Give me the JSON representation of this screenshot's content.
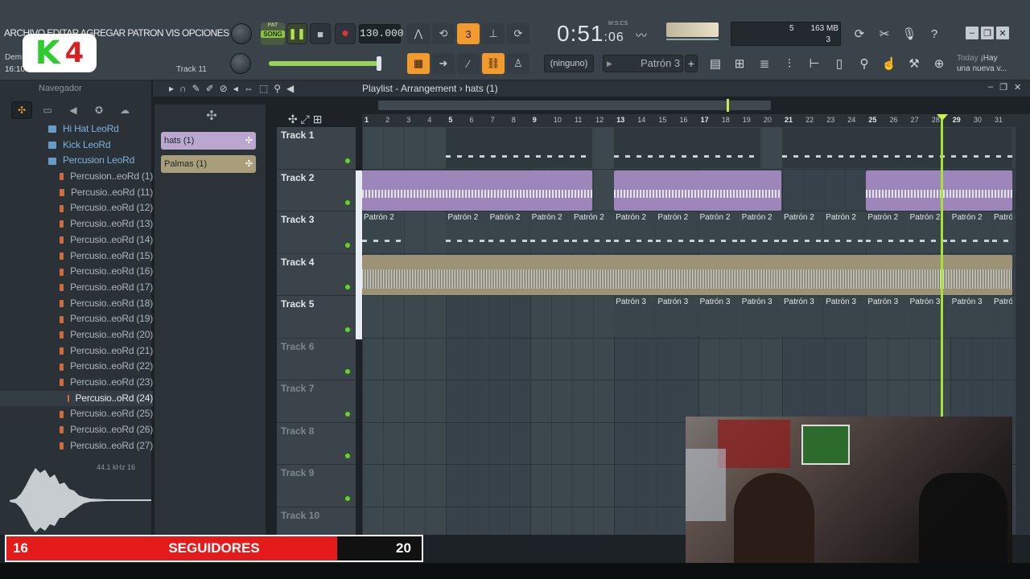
{
  "menu": {
    "text": "ARCHIVO EDITAR AGREGAR PATRON VIS OPCIONES HERRAMIENTA"
  },
  "hints": {
    "line1": "Dem",
    "line2": "16:10:1",
    "track": "Track 11"
  },
  "logo": {
    "k": "K",
    "num": "4"
  },
  "transport": {
    "pat": "PAT",
    "song": "SONG",
    "play": "❚❚",
    "stop": "■",
    "rec": "●",
    "tempo": "130.000"
  },
  "time": {
    "main": "0:51",
    "sub": ":06",
    "label": "M:S:CS"
  },
  "cpu": {
    "voices": "5",
    "mem": "163 MB",
    "poly": "3"
  },
  "pattern": {
    "none": "(ninguno)",
    "current": "Patrón 3",
    "plus": "+"
  },
  "news": {
    "line1": "Today",
    "line1b": "¡Hay",
    "line2": "una nueva v..."
  },
  "window_buttons": [
    "‒",
    "❐",
    "✕"
  ],
  "browser": {
    "title": "Navegador",
    "items": [
      {
        "label": "Hi Hat LeoRd",
        "type": "folder",
        "indent": 60
      },
      {
        "label": "Kick LeoRd",
        "type": "folder",
        "indent": 60
      },
      {
        "label": "Percusion  LeoRd",
        "type": "folder",
        "indent": 60
      },
      {
        "label": "Percusion..eoRd (1)",
        "type": "file",
        "indent": 74
      },
      {
        "label": "Percusio..eoRd (11)",
        "type": "file",
        "indent": 74
      },
      {
        "label": "Percusio..eoRd (12)",
        "type": "file",
        "indent": 74
      },
      {
        "label": "Percusio..eoRd (13)",
        "type": "file",
        "indent": 74
      },
      {
        "label": "Percusio..eoRd (14)",
        "type": "file",
        "indent": 74
      },
      {
        "label": "Percusio..eoRd (15)",
        "type": "file",
        "indent": 74
      },
      {
        "label": "Percusio..eoRd (16)",
        "type": "file",
        "indent": 74
      },
      {
        "label": "Percusio..eoRd (17)",
        "type": "file",
        "indent": 74
      },
      {
        "label": "Percusio..eoRd (18)",
        "type": "file",
        "indent": 74
      },
      {
        "label": "Percusio..eoRd (19)",
        "type": "file",
        "indent": 74
      },
      {
        "label": "Percusio..eoRd (20)",
        "type": "file",
        "indent": 74
      },
      {
        "label": "Percusio..eoRd (21)",
        "type": "file",
        "indent": 74
      },
      {
        "label": "Percusio..eoRd (22)",
        "type": "file",
        "indent": 74
      },
      {
        "label": "Percusio..eoRd (23)",
        "type": "file",
        "indent": 74
      },
      {
        "label": "Percusio..oRd (24)",
        "type": "file",
        "indent": 84,
        "selected": true
      },
      {
        "label": "Percusio..eoRd (25)",
        "type": "file",
        "indent": 74
      },
      {
        "label": "Percusio..eoRd (26)",
        "type": "file",
        "indent": 74
      },
      {
        "label": "Percusio..eoRd (27)",
        "type": "file",
        "indent": 74
      }
    ],
    "sample_info": "44.1 kHz 16"
  },
  "picker": {
    "items": [
      {
        "label": "hats (1)",
        "color": "#b9a7d0"
      },
      {
        "label": "Palmas (1)",
        "color": "#a89e79"
      }
    ]
  },
  "playlist": {
    "title": "Playlist - Arrangement",
    "sep": "›",
    "current": "hats (1)",
    "bars": [
      "1",
      "2",
      "3",
      "4",
      "5",
      "6",
      "7",
      "8",
      "9",
      "10",
      "11",
      "12",
      "13",
      "14",
      "15",
      "16",
      "17",
      "18",
      "19",
      "20",
      "21",
      "22",
      "23",
      "24",
      "25",
      "26",
      "27",
      "28",
      "29",
      "30",
      "31"
    ],
    "tracks": [
      "Track 1",
      "Track 2",
      "Track 3",
      "Track 4",
      "Track 5",
      "Track 6",
      "Track 7",
      "Track 8",
      "Track 9",
      "Track 10"
    ],
    "clip_label_p2": "Patrón 2",
    "clip_label_p3": "Patrón 3"
  },
  "followers": {
    "current": "16",
    "label": "SEGUIDORES",
    "goal": "20",
    "progress": 0.8
  },
  "colors": {
    "purple_clip": "#9d86b9",
    "olive_clip": "#9c9276",
    "pattern_clip": "#55626a",
    "accent": "#f19a2e",
    "playhead": "#a5e23a",
    "follow_red": "#e51b1b"
  }
}
